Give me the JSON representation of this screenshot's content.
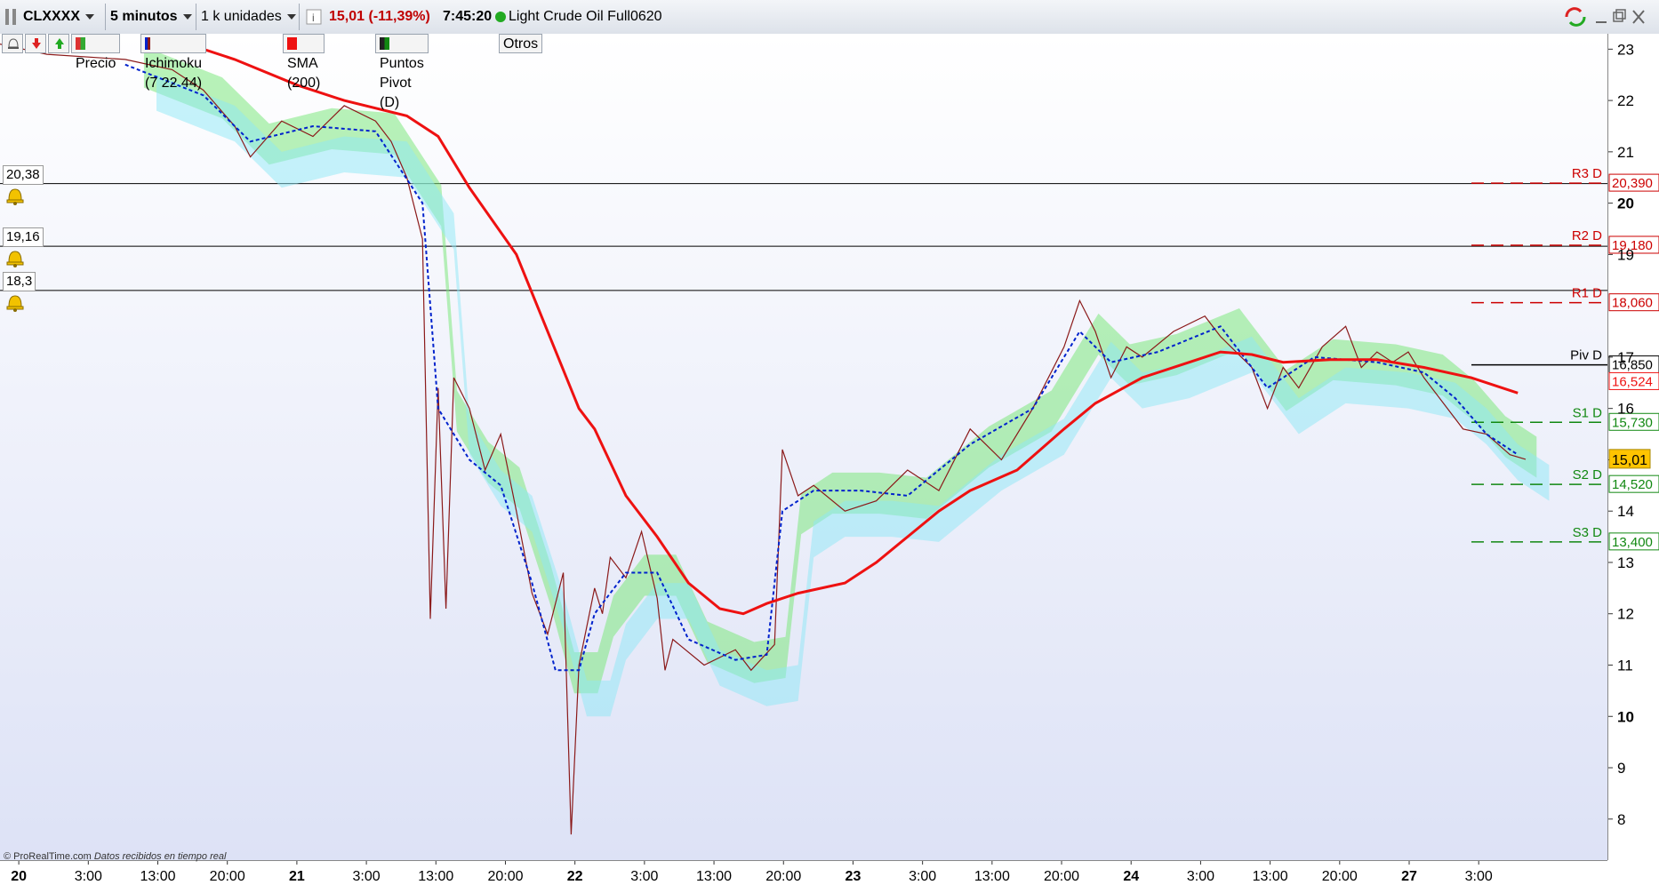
{
  "toolbar": {
    "symbol": "CLXXXX",
    "interval": "5 minutos",
    "units": "1 k unidades",
    "last_price": "15,01 (-11,39%)",
    "time": "7:45:20",
    "instrument": "Light Crude Oil Full0620"
  },
  "legend": {
    "price": "Precio",
    "ichimoku": "Ichimoku (7 22 44)",
    "sma": "SMA (200)",
    "pivots": "Puntos Pivot (D)",
    "others": "Otros"
  },
  "alerts": [
    {
      "label": "20,38",
      "value": 20.38
    },
    {
      "label": "19,16",
      "value": 19.16
    },
    {
      "label": "18,3",
      "value": 18.3
    }
  ],
  "credit": "© ProRealTime.com",
  "credit_note": "Datos recibidos en tiempo real",
  "chart_data": {
    "type": "line",
    "ylim": [
      7.2,
      23.3
    ],
    "y_ticks": [
      "8",
      "9",
      "10",
      "11",
      "12",
      "13",
      "14",
      "15",
      "16",
      "17",
      "19",
      "20",
      "21",
      "22",
      "23"
    ],
    "x_ticks": [
      {
        "label": "20",
        "bold": true
      },
      {
        "label": "3:00"
      },
      {
        "label": "13:00"
      },
      {
        "label": "20:00"
      },
      {
        "label": "21",
        "bold": true
      },
      {
        "label": "3:00"
      },
      {
        "label": "13:00"
      },
      {
        "label": "20:00"
      },
      {
        "label": "22",
        "bold": true
      },
      {
        "label": "3:00"
      },
      {
        "label": "13:00"
      },
      {
        "label": "20:00"
      },
      {
        "label": "23",
        "bold": true
      },
      {
        "label": "3:00"
      },
      {
        "label": "13:00"
      },
      {
        "label": "20:00"
      },
      {
        "label": "24",
        "bold": true
      },
      {
        "label": "3:00"
      },
      {
        "label": "13:00"
      },
      {
        "label": "20:00"
      },
      {
        "label": "27",
        "bold": true
      },
      {
        "label": "3:00"
      }
    ],
    "pivots": [
      {
        "name": "R3 D",
        "value": 20.39,
        "label": "20,390",
        "color": "#cc0000"
      },
      {
        "name": "R2 D",
        "value": 19.18,
        "label": "19,180",
        "color": "#cc0000"
      },
      {
        "name": "R1 D",
        "value": 18.06,
        "label": "18,060",
        "color": "#cc0000"
      },
      {
        "name": "Piv D",
        "value": 16.85,
        "label": "16,850",
        "color": "#000000"
      },
      {
        "name": "S1 D",
        "value": 15.73,
        "label": "15,730",
        "color": "#118811"
      },
      {
        "name": "S2 D",
        "value": 14.52,
        "label": "14,520",
        "color": "#118811"
      },
      {
        "name": "S3 D",
        "value": 13.4,
        "label": "13,400",
        "color": "#118811"
      }
    ],
    "sma_last": {
      "value": 16.524,
      "label": "16,524"
    },
    "last": {
      "value": 15.01,
      "label": "15,01"
    },
    "series": [
      {
        "name": "Precio",
        "color": "#8b1a1a",
        "points": [
          [
            0,
            23.1
          ],
          [
            0.03,
            22.9
          ],
          [
            0.08,
            22.8
          ],
          [
            0.11,
            22.6
          ],
          [
            0.13,
            22.2
          ],
          [
            0.15,
            21.5
          ],
          [
            0.16,
            20.9
          ],
          [
            0.18,
            21.6
          ],
          [
            0.2,
            21.3
          ],
          [
            0.22,
            21.9
          ],
          [
            0.24,
            21.6
          ],
          [
            0.25,
            21.2
          ],
          [
            0.26,
            20.5
          ],
          [
            0.27,
            19.3
          ],
          [
            0.275,
            11.9
          ],
          [
            0.28,
            16.4
          ],
          [
            0.285,
            12.1
          ],
          [
            0.29,
            16.6
          ],
          [
            0.3,
            16.0
          ],
          [
            0.31,
            14.8
          ],
          [
            0.32,
            15.5
          ],
          [
            0.33,
            14.0
          ],
          [
            0.34,
            12.4
          ],
          [
            0.35,
            11.6
          ],
          [
            0.36,
            12.8
          ],
          [
            0.365,
            7.7
          ],
          [
            0.37,
            11.0
          ],
          [
            0.38,
            12.5
          ],
          [
            0.385,
            12.0
          ],
          [
            0.39,
            13.1
          ],
          [
            0.4,
            12.7
          ],
          [
            0.41,
            13.6
          ],
          [
            0.42,
            12.3
          ],
          [
            0.425,
            10.9
          ],
          [
            0.43,
            11.5
          ],
          [
            0.45,
            11.0
          ],
          [
            0.47,
            11.3
          ],
          [
            0.48,
            10.9
          ],
          [
            0.495,
            11.4
          ],
          [
            0.5,
            15.2
          ],
          [
            0.51,
            14.3
          ],
          [
            0.52,
            14.5
          ],
          [
            0.54,
            14.0
          ],
          [
            0.56,
            14.2
          ],
          [
            0.58,
            14.8
          ],
          [
            0.6,
            14.4
          ],
          [
            0.62,
            15.6
          ],
          [
            0.64,
            15.0
          ],
          [
            0.66,
            16.0
          ],
          [
            0.68,
            17.2
          ],
          [
            0.69,
            18.1
          ],
          [
            0.7,
            17.5
          ],
          [
            0.71,
            16.6
          ],
          [
            0.72,
            17.2
          ],
          [
            0.73,
            17.0
          ],
          [
            0.75,
            17.5
          ],
          [
            0.77,
            17.8
          ],
          [
            0.78,
            17.4
          ],
          [
            0.8,
            16.8
          ],
          [
            0.81,
            16.0
          ],
          [
            0.82,
            16.8
          ],
          [
            0.83,
            16.4
          ],
          [
            0.845,
            17.2
          ],
          [
            0.86,
            17.6
          ],
          [
            0.87,
            16.8
          ],
          [
            0.88,
            17.1
          ],
          [
            0.89,
            16.9
          ],
          [
            0.9,
            17.1
          ],
          [
            0.91,
            16.6
          ],
          [
            0.92,
            16.2
          ],
          [
            0.935,
            15.6
          ],
          [
            0.95,
            15.5
          ],
          [
            0.965,
            15.1
          ],
          [
            0.975,
            15.01
          ]
        ]
      },
      {
        "name": "Ichimoku",
        "color": "#0022cc",
        "points": [
          [
            0.08,
            22.7
          ],
          [
            0.13,
            22.1
          ],
          [
            0.16,
            21.2
          ],
          [
            0.2,
            21.5
          ],
          [
            0.24,
            21.4
          ],
          [
            0.27,
            20.0
          ],
          [
            0.28,
            16.0
          ],
          [
            0.3,
            15.0
          ],
          [
            0.32,
            14.5
          ],
          [
            0.34,
            12.6
          ],
          [
            0.355,
            10.9
          ],
          [
            0.37,
            10.9
          ],
          [
            0.38,
            12.0
          ],
          [
            0.4,
            12.8
          ],
          [
            0.42,
            12.8
          ],
          [
            0.44,
            11.5
          ],
          [
            0.47,
            11.1
          ],
          [
            0.49,
            11.2
          ],
          [
            0.5,
            14.0
          ],
          [
            0.52,
            14.4
          ],
          [
            0.55,
            14.4
          ],
          [
            0.58,
            14.3
          ],
          [
            0.62,
            15.3
          ],
          [
            0.66,
            16.0
          ],
          [
            0.69,
            17.5
          ],
          [
            0.71,
            16.9
          ],
          [
            0.74,
            17.1
          ],
          [
            0.78,
            17.6
          ],
          [
            0.81,
            16.4
          ],
          [
            0.84,
            17.0
          ],
          [
            0.88,
            16.9
          ],
          [
            0.91,
            16.7
          ],
          [
            0.93,
            16.2
          ],
          [
            0.95,
            15.5
          ],
          [
            0.97,
            15.1
          ]
        ]
      },
      {
        "name": "SMA (200)",
        "color": "#ee1111",
        "points": [
          [
            0.11,
            23.2
          ],
          [
            0.15,
            22.8
          ],
          [
            0.19,
            22.3
          ],
          [
            0.22,
            22.0
          ],
          [
            0.26,
            21.7
          ],
          [
            0.28,
            21.3
          ],
          [
            0.3,
            20.3
          ],
          [
            0.33,
            19.0
          ],
          [
            0.37,
            16.0
          ],
          [
            0.38,
            15.6
          ],
          [
            0.4,
            14.3
          ],
          [
            0.42,
            13.5
          ],
          [
            0.44,
            12.6
          ],
          [
            0.46,
            12.1
          ],
          [
            0.475,
            12.0
          ],
          [
            0.49,
            12.2
          ],
          [
            0.51,
            12.4
          ],
          [
            0.54,
            12.6
          ],
          [
            0.56,
            13.0
          ],
          [
            0.58,
            13.5
          ],
          [
            0.6,
            14.0
          ],
          [
            0.62,
            14.4
          ],
          [
            0.65,
            14.8
          ],
          [
            0.68,
            15.6
          ],
          [
            0.7,
            16.1
          ],
          [
            0.73,
            16.6
          ],
          [
            0.76,
            16.9
          ],
          [
            0.78,
            17.1
          ],
          [
            0.8,
            17.05
          ],
          [
            0.82,
            16.9
          ],
          [
            0.85,
            16.95
          ],
          [
            0.88,
            16.95
          ],
          [
            0.91,
            16.8
          ],
          [
            0.94,
            16.6
          ],
          [
            0.97,
            16.3
          ]
        ]
      }
    ]
  }
}
